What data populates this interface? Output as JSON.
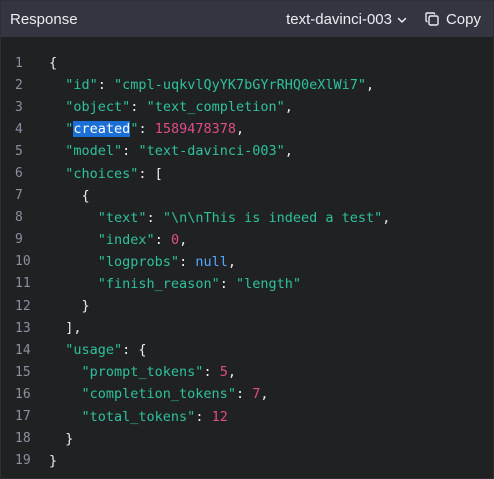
{
  "header": {
    "title": "Response",
    "model_label": "text-davinci-003",
    "copy_label": "Copy"
  },
  "code": {
    "lines": [
      {
        "num": "1",
        "tokens": [
          {
            "t": "{",
            "c": "p"
          }
        ]
      },
      {
        "num": "2",
        "tokens": [
          {
            "t": "  ",
            "c": "p"
          },
          {
            "t": "\"id\"",
            "c": "k"
          },
          {
            "t": ": ",
            "c": "p"
          },
          {
            "t": "\"cmpl-uqkvlQyYK7bGYrRHQ0eXlWi7\"",
            "c": "s"
          },
          {
            "t": ",",
            "c": "p"
          }
        ]
      },
      {
        "num": "3",
        "tokens": [
          {
            "t": "  ",
            "c": "p"
          },
          {
            "t": "\"object\"",
            "c": "k"
          },
          {
            "t": ": ",
            "c": "p"
          },
          {
            "t": "\"text_completion\"",
            "c": "s"
          },
          {
            "t": ",",
            "c": "p"
          }
        ]
      },
      {
        "num": "4",
        "tokens": [
          {
            "t": "  ",
            "c": "p"
          },
          {
            "t": "\"",
            "c": "k"
          },
          {
            "t": "created",
            "c": "hl"
          },
          {
            "t": "\"",
            "c": "k"
          },
          {
            "t": ": ",
            "c": "p"
          },
          {
            "t": "1589478378",
            "c": "n"
          },
          {
            "t": ",",
            "c": "p"
          }
        ]
      },
      {
        "num": "5",
        "tokens": [
          {
            "t": "  ",
            "c": "p"
          },
          {
            "t": "\"model\"",
            "c": "k"
          },
          {
            "t": ": ",
            "c": "p"
          },
          {
            "t": "\"text-davinci-003\"",
            "c": "s"
          },
          {
            "t": ",",
            "c": "p"
          }
        ]
      },
      {
        "num": "6",
        "tokens": [
          {
            "t": "  ",
            "c": "p"
          },
          {
            "t": "\"choices\"",
            "c": "k"
          },
          {
            "t": ": [",
            "c": "p"
          }
        ]
      },
      {
        "num": "7",
        "tokens": [
          {
            "t": "    {",
            "c": "p"
          }
        ]
      },
      {
        "num": "8",
        "tokens": [
          {
            "t": "      ",
            "c": "p"
          },
          {
            "t": "\"text\"",
            "c": "k"
          },
          {
            "t": ": ",
            "c": "p"
          },
          {
            "t": "\"\\n\\nThis is indeed a test\"",
            "c": "s"
          },
          {
            "t": ",",
            "c": "p"
          }
        ]
      },
      {
        "num": "9",
        "tokens": [
          {
            "t": "      ",
            "c": "p"
          },
          {
            "t": "\"index\"",
            "c": "k"
          },
          {
            "t": ": ",
            "c": "p"
          },
          {
            "t": "0",
            "c": "n"
          },
          {
            "t": ",",
            "c": "p"
          }
        ]
      },
      {
        "num": "10",
        "tokens": [
          {
            "t": "      ",
            "c": "p"
          },
          {
            "t": "\"logprobs\"",
            "c": "k"
          },
          {
            "t": ": ",
            "c": "p"
          },
          {
            "t": "null",
            "c": "kw"
          },
          {
            "t": ",",
            "c": "p"
          }
        ]
      },
      {
        "num": "11",
        "tokens": [
          {
            "t": "      ",
            "c": "p"
          },
          {
            "t": "\"finish_reason\"",
            "c": "k"
          },
          {
            "t": ": ",
            "c": "p"
          },
          {
            "t": "\"length\"",
            "c": "s"
          }
        ]
      },
      {
        "num": "12",
        "tokens": [
          {
            "t": "    }",
            "c": "p"
          }
        ]
      },
      {
        "num": "13",
        "tokens": [
          {
            "t": "  ],",
            "c": "p"
          }
        ]
      },
      {
        "num": "14",
        "tokens": [
          {
            "t": "  ",
            "c": "p"
          },
          {
            "t": "\"usage\"",
            "c": "k"
          },
          {
            "t": ": {",
            "c": "p"
          }
        ]
      },
      {
        "num": "15",
        "tokens": [
          {
            "t": "    ",
            "c": "p"
          },
          {
            "t": "\"prompt_tokens\"",
            "c": "k"
          },
          {
            "t": ": ",
            "c": "p"
          },
          {
            "t": "5",
            "c": "n"
          },
          {
            "t": ",",
            "c": "p"
          }
        ]
      },
      {
        "num": "16",
        "tokens": [
          {
            "t": "    ",
            "c": "p"
          },
          {
            "t": "\"completion_tokens\"",
            "c": "k"
          },
          {
            "t": ": ",
            "c": "p"
          },
          {
            "t": "7",
            "c": "n"
          },
          {
            "t": ",",
            "c": "p"
          }
        ]
      },
      {
        "num": "17",
        "tokens": [
          {
            "t": "    ",
            "c": "p"
          },
          {
            "t": "\"total_tokens\"",
            "c": "k"
          },
          {
            "t": ": ",
            "c": "p"
          },
          {
            "t": "12",
            "c": "n"
          }
        ]
      },
      {
        "num": "18",
        "tokens": [
          {
            "t": "  }",
            "c": "p"
          }
        ]
      },
      {
        "num": "19",
        "tokens": [
          {
            "t": "}",
            "c": "p"
          }
        ]
      }
    ]
  }
}
